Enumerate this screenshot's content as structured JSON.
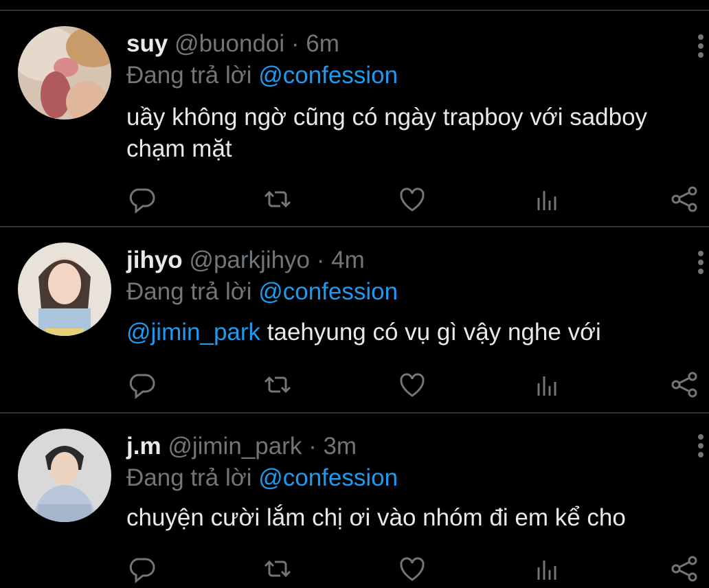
{
  "tweets": [
    {
      "name": "suy",
      "handle": "@buondoi",
      "sep": " · ",
      "time": "6m",
      "reply_prefix": "Đang trả lời ",
      "reply_to": "@confession",
      "mention": "",
      "text": "uầy không ngờ cũng có ngày trapboy với sadboy chạm mặt",
      "avatar": "cat-avatar"
    },
    {
      "name": "jihyo",
      "handle": "@parkjihyo",
      "sep": " · ",
      "time": "4m",
      "reply_prefix": "Đang trả lời ",
      "reply_to": "@confession",
      "mention": "@jimin_park",
      "text": " taehyung có vụ gì vậy nghe với",
      "avatar": "girl-avatar"
    },
    {
      "name": "j.m",
      "handle": "@jimin_park",
      "sep": " · ",
      "time": "3m",
      "reply_prefix": "Đang trả lời ",
      "reply_to": "@confession",
      "mention": "",
      "text": "chuyện cười lắm chị ơi vào nhóm đi em kể cho",
      "avatar": "boy-avatar"
    }
  ],
  "icons": [
    "reply-icon",
    "retweet-icon",
    "like-icon",
    "analytics-icon",
    "share-icon",
    "more-icon"
  ],
  "colors": {
    "background": "#000000",
    "text": "#e7e9ea",
    "muted": "#71767b",
    "link": "#1d9bf0",
    "divider": "#2f3336"
  }
}
